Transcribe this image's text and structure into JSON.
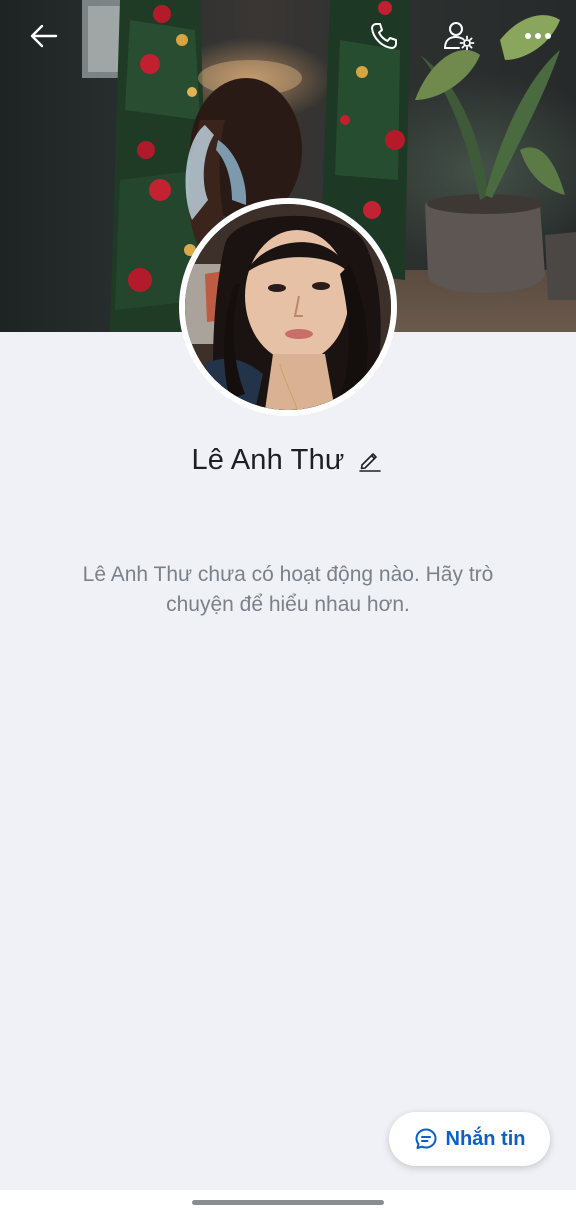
{
  "profile": {
    "name": "Lê Anh Thư",
    "empty_message": "Lê Anh Thư chưa có hoạt động nào. Hãy trò chuyện để hiểu nhau hơn."
  },
  "actions": {
    "message_label": "Nhắn tin"
  },
  "icons": {
    "back": "arrow-left-icon",
    "call": "phone-icon",
    "settings": "user-gear-icon",
    "more": "more-horizontal-icon",
    "edit": "pencil-icon",
    "message": "chat-bubble-icon"
  },
  "colors": {
    "background": "#f0f1f6",
    "accent": "#0b5fc7",
    "text_primary": "#1d1f23",
    "text_secondary": "#7b818b"
  }
}
